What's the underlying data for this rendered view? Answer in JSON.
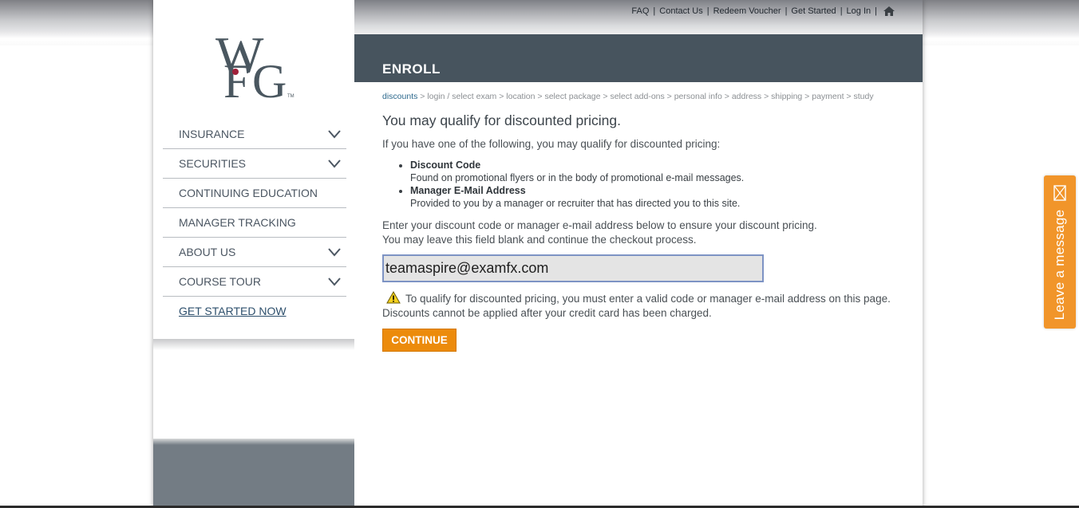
{
  "top_links": [
    "FAQ",
    "Contact Us",
    "Redeem Voucher",
    "Get Started",
    "Log In"
  ],
  "logo": {
    "text": "WFG",
    "tm": "TM"
  },
  "nav": [
    {
      "label": "INSURANCE",
      "dropdown": true
    },
    {
      "label": "SECURITIES",
      "dropdown": true
    },
    {
      "label": "CONTINUING EDUCATION",
      "dropdown": false
    },
    {
      "label": "MANAGER TRACKING",
      "dropdown": false
    },
    {
      "label": "ABOUT US",
      "dropdown": true
    },
    {
      "label": "COURSE TOUR",
      "dropdown": true
    },
    {
      "label": "GET STARTED NOW",
      "dropdown": false
    }
  ],
  "page": {
    "title": "ENROLL",
    "breadcrumb": [
      "discounts",
      "login / select exam",
      "location",
      "select package",
      "select add-ons",
      "personal info",
      "address",
      "shipping",
      "payment",
      "study"
    ],
    "heading": "You may qualify for discounted pricing.",
    "intro": "If you have one of the following, you may qualify for discounted pricing:",
    "options": [
      {
        "title": "Discount Code",
        "desc": "Found on promotional flyers or in the body of promotional e-mail messages."
      },
      {
        "title": "Manager E-Mail Address",
        "desc": "Provided to you by a manager or recruiter that has directed you to this site."
      }
    ],
    "enter_line1": "Enter your discount code or manager e-mail address below to ensure your discount pricing.",
    "enter_line2": "You may leave this field blank and continue the checkout process.",
    "input_value": "teamaspire@examfx.com",
    "warning": "To qualify for discounted pricing, you must enter a valid code or manager e-mail address on this page. Discounts cannot be applied after your credit card has been charged.",
    "continue_label": "CONTINUE"
  },
  "chat_tab": {
    "label": "Leave a message"
  },
  "colors": {
    "header_bar": "#47545e",
    "accent": "#ec8b0b",
    "link": "#2e6a8e",
    "chat": "#f1952a"
  }
}
